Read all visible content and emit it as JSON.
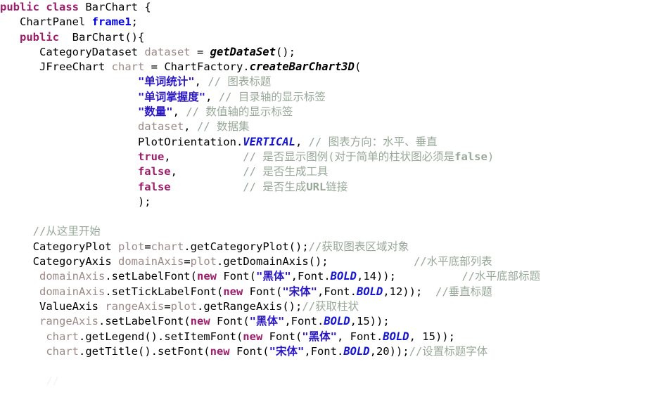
{
  "editor": {
    "language": "java",
    "background": "#ffffff",
    "colors": {
      "keyword": "#9B1E6B",
      "string": "#2A17C4",
      "comment": "#98A898",
      "field": "#0000E6",
      "variable": "#9C8A88",
      "static_field": "#1414D2",
      "plain": "#000000"
    }
  },
  "code": {
    "lines": [
      {
        "n": 1,
        "indent": 0,
        "tokens": [
          {
            "t": "public",
            "k": "kw"
          },
          {
            "t": " ",
            "k": "plain"
          },
          {
            "t": "class",
            "k": "kw"
          },
          {
            "t": " BarChart {",
            "k": "plain"
          }
        ]
      },
      {
        "n": 2,
        "indent": 3,
        "tokens": [
          {
            "t": "ChartPanel ",
            "k": "type"
          },
          {
            "t": "frame1",
            "k": "field"
          },
          {
            "t": ";",
            "k": "plain"
          }
        ]
      },
      {
        "n": 3,
        "indent": 3,
        "tokens": [
          {
            "t": "public",
            "k": "kw"
          },
          {
            "t": "  BarChart(){",
            "k": "plain"
          }
        ]
      },
      {
        "n": 4,
        "indent": 6,
        "tokens": [
          {
            "t": "CategoryDataset ",
            "k": "type"
          },
          {
            "t": "dataset",
            "k": "var"
          },
          {
            "t": " = ",
            "k": "plain"
          },
          {
            "t": "getDataSet",
            "k": "method"
          },
          {
            "t": "();",
            "k": "plain"
          }
        ]
      },
      {
        "n": 5,
        "indent": 6,
        "tokens": [
          {
            "t": "JFreeChart ",
            "k": "type"
          },
          {
            "t": "chart",
            "k": "var"
          },
          {
            "t": " = ChartFactory.",
            "k": "plain"
          },
          {
            "t": "createBarChart3D",
            "k": "method"
          },
          {
            "t": "(",
            "k": "plain"
          }
        ]
      },
      {
        "n": 6,
        "indent": 21,
        "tokens": [
          {
            "t": "\"单词统计\"",
            "k": "str"
          },
          {
            "t": ", ",
            "k": "plain"
          },
          {
            "t": "//",
            "k": "cmt"
          },
          {
            "t": " 图表标题",
            "k": "cmt"
          }
        ]
      },
      {
        "n": 7,
        "indent": 21,
        "tokens": [
          {
            "t": "\"单词掌握度\"",
            "k": "str"
          },
          {
            "t": ", ",
            "k": "plain"
          },
          {
            "t": "//",
            "k": "cmt"
          },
          {
            "t": " 目录轴的显示标签",
            "k": "cmt"
          }
        ]
      },
      {
        "n": 8,
        "indent": 21,
        "tokens": [
          {
            "t": "\"数量\"",
            "k": "str"
          },
          {
            "t": ", ",
            "k": "plain"
          },
          {
            "t": "//",
            "k": "cmt"
          },
          {
            "t": " 数值轴的显示标签",
            "k": "cmt"
          }
        ]
      },
      {
        "n": 9,
        "indent": 21,
        "tokens": [
          {
            "t": "dataset",
            "k": "var"
          },
          {
            "t": ", ",
            "k": "plain"
          },
          {
            "t": "//",
            "k": "cmt"
          },
          {
            "t": " 数据集",
            "k": "cmt"
          }
        ]
      },
      {
        "n": 10,
        "indent": 21,
        "tokens": [
          {
            "t": "PlotOrientation.",
            "k": "plain"
          },
          {
            "t": "VERTICAL",
            "k": "staticf"
          },
          {
            "t": ", ",
            "k": "plain"
          },
          {
            "t": "//",
            "k": "cmt"
          },
          {
            "t": " 图表方向：水平、垂直",
            "k": "cmt"
          }
        ]
      },
      {
        "n": 11,
        "indent": 21,
        "tokens": [
          {
            "t": "true",
            "k": "kw"
          },
          {
            "t": ",",
            "k": "plain"
          },
          {
            "t": "           ",
            "k": "plain"
          },
          {
            "t": "//",
            "k": "cmt"
          },
          {
            "t": " 是否显示图例(对于简单的柱状图必须是",
            "k": "cmt"
          },
          {
            "t": "false",
            "k": "cmt-b"
          },
          {
            "t": ")",
            "k": "cmt"
          }
        ]
      },
      {
        "n": 12,
        "indent": 21,
        "tokens": [
          {
            "t": "false",
            "k": "kw"
          },
          {
            "t": ",",
            "k": "plain"
          },
          {
            "t": "          ",
            "k": "plain"
          },
          {
            "t": "//",
            "k": "cmt"
          },
          {
            "t": " 是否生成工具",
            "k": "cmt"
          }
        ]
      },
      {
        "n": 13,
        "indent": 21,
        "tokens": [
          {
            "t": "false",
            "k": "kw"
          },
          {
            "t": "           ",
            "k": "plain"
          },
          {
            "t": "//",
            "k": "cmt"
          },
          {
            "t": " 是否生成",
            "k": "cmt"
          },
          {
            "t": "URL",
            "k": "cmt-b"
          },
          {
            "t": "链接",
            "k": "cmt"
          }
        ]
      },
      {
        "n": 14,
        "indent": 21,
        "tokens": [
          {
            "t": ");",
            "k": "plain"
          }
        ]
      },
      {
        "n": 15,
        "indent": 0,
        "tokens": []
      },
      {
        "n": 16,
        "indent": 5,
        "tokens": [
          {
            "t": "//从这里开始",
            "k": "cmt"
          }
        ]
      },
      {
        "n": 17,
        "indent": 5,
        "tokens": [
          {
            "t": "CategoryPlot ",
            "k": "type"
          },
          {
            "t": "plot",
            "k": "var"
          },
          {
            "t": "=",
            "k": "plain"
          },
          {
            "t": "chart",
            "k": "var"
          },
          {
            "t": ".getCategoryPlot();",
            "k": "plain"
          },
          {
            "t": "//获取图表区域对象",
            "k": "cmt"
          }
        ]
      },
      {
        "n": 18,
        "indent": 5,
        "tokens": [
          {
            "t": "CategoryAxis ",
            "k": "type"
          },
          {
            "t": "domainAxis",
            "k": "var"
          },
          {
            "t": "=",
            "k": "plain"
          },
          {
            "t": "plot",
            "k": "var"
          },
          {
            "t": ".getDomainAxis();",
            "k": "plain"
          },
          {
            "t": "             ",
            "k": "plain"
          },
          {
            "t": "//水平底部列表",
            "k": "cmt"
          }
        ]
      },
      {
        "n": 19,
        "indent": 6,
        "tokens": [
          {
            "t": "domainAxis",
            "k": "var"
          },
          {
            "t": ".setLabelFont(",
            "k": "plain"
          },
          {
            "t": "new",
            "k": "kw"
          },
          {
            "t": " Font(",
            "k": "plain"
          },
          {
            "t": "\"黑体\"",
            "k": "str"
          },
          {
            "t": ",Font.",
            "k": "plain"
          },
          {
            "t": "BOLD",
            "k": "staticf"
          },
          {
            "t": ",14));",
            "k": "plain"
          },
          {
            "t": "          ",
            "k": "plain"
          },
          {
            "t": "//水平底部标题",
            "k": "cmt"
          }
        ]
      },
      {
        "n": 20,
        "indent": 6,
        "tokens": [
          {
            "t": "domainAxis",
            "k": "var"
          },
          {
            "t": ".setTickLabelFont(",
            "k": "plain"
          },
          {
            "t": "new",
            "k": "kw"
          },
          {
            "t": " Font(",
            "k": "plain"
          },
          {
            "t": "\"宋体\"",
            "k": "str"
          },
          {
            "t": ",Font.",
            "k": "plain"
          },
          {
            "t": "BOLD",
            "k": "staticf"
          },
          {
            "t": ",12));",
            "k": "plain"
          },
          {
            "t": "  ",
            "k": "plain"
          },
          {
            "t": "//垂直标题",
            "k": "cmt"
          }
        ]
      },
      {
        "n": 21,
        "indent": 6,
        "tokens": [
          {
            "t": "ValueAxis ",
            "k": "type"
          },
          {
            "t": "rangeAxis",
            "k": "var"
          },
          {
            "t": "=",
            "k": "plain"
          },
          {
            "t": "plot",
            "k": "var"
          },
          {
            "t": ".getRangeAxis();",
            "k": "plain"
          },
          {
            "t": "//获取柱状",
            "k": "cmt"
          }
        ]
      },
      {
        "n": 22,
        "indent": 6,
        "tokens": [
          {
            "t": "rangeAxis",
            "k": "var"
          },
          {
            "t": ".setLabelFont(",
            "k": "plain"
          },
          {
            "t": "new",
            "k": "kw"
          },
          {
            "t": " Font(",
            "k": "plain"
          },
          {
            "t": "\"黑体\"",
            "k": "str"
          },
          {
            "t": ",Font.",
            "k": "plain"
          },
          {
            "t": "BOLD",
            "k": "staticf"
          },
          {
            "t": ",15));",
            "k": "plain"
          }
        ]
      },
      {
        "n": 23,
        "indent": 7,
        "tokens": [
          {
            "t": "chart",
            "k": "var"
          },
          {
            "t": ".getLegend().setItemFont(",
            "k": "plain"
          },
          {
            "t": "new",
            "k": "kw"
          },
          {
            "t": " Font(",
            "k": "plain"
          },
          {
            "t": "\"黑体\"",
            "k": "str"
          },
          {
            "t": ", Font.",
            "k": "plain"
          },
          {
            "t": "BOLD",
            "k": "staticf"
          },
          {
            "t": ", 15));",
            "k": "plain"
          }
        ]
      },
      {
        "n": 24,
        "indent": 7,
        "tokens": [
          {
            "t": "chart",
            "k": "var"
          },
          {
            "t": ".getTitle().setFont(",
            "k": "plain"
          },
          {
            "t": "new",
            "k": "kw"
          },
          {
            "t": " Font(",
            "k": "plain"
          },
          {
            "t": "\"宋体\"",
            "k": "str"
          },
          {
            "t": ",Font.",
            "k": "plain"
          },
          {
            "t": "BOLD",
            "k": "staticf"
          },
          {
            "t": ",20));",
            "k": "plain"
          },
          {
            "t": "//设置标题字体",
            "k": "cmt"
          }
        ]
      },
      {
        "n": 25,
        "indent": 0,
        "tokens": []
      },
      {
        "n": 26,
        "indent": 7,
        "tokens": [
          {
            "t": "//",
            "k": "faint"
          }
        ]
      }
    ]
  }
}
